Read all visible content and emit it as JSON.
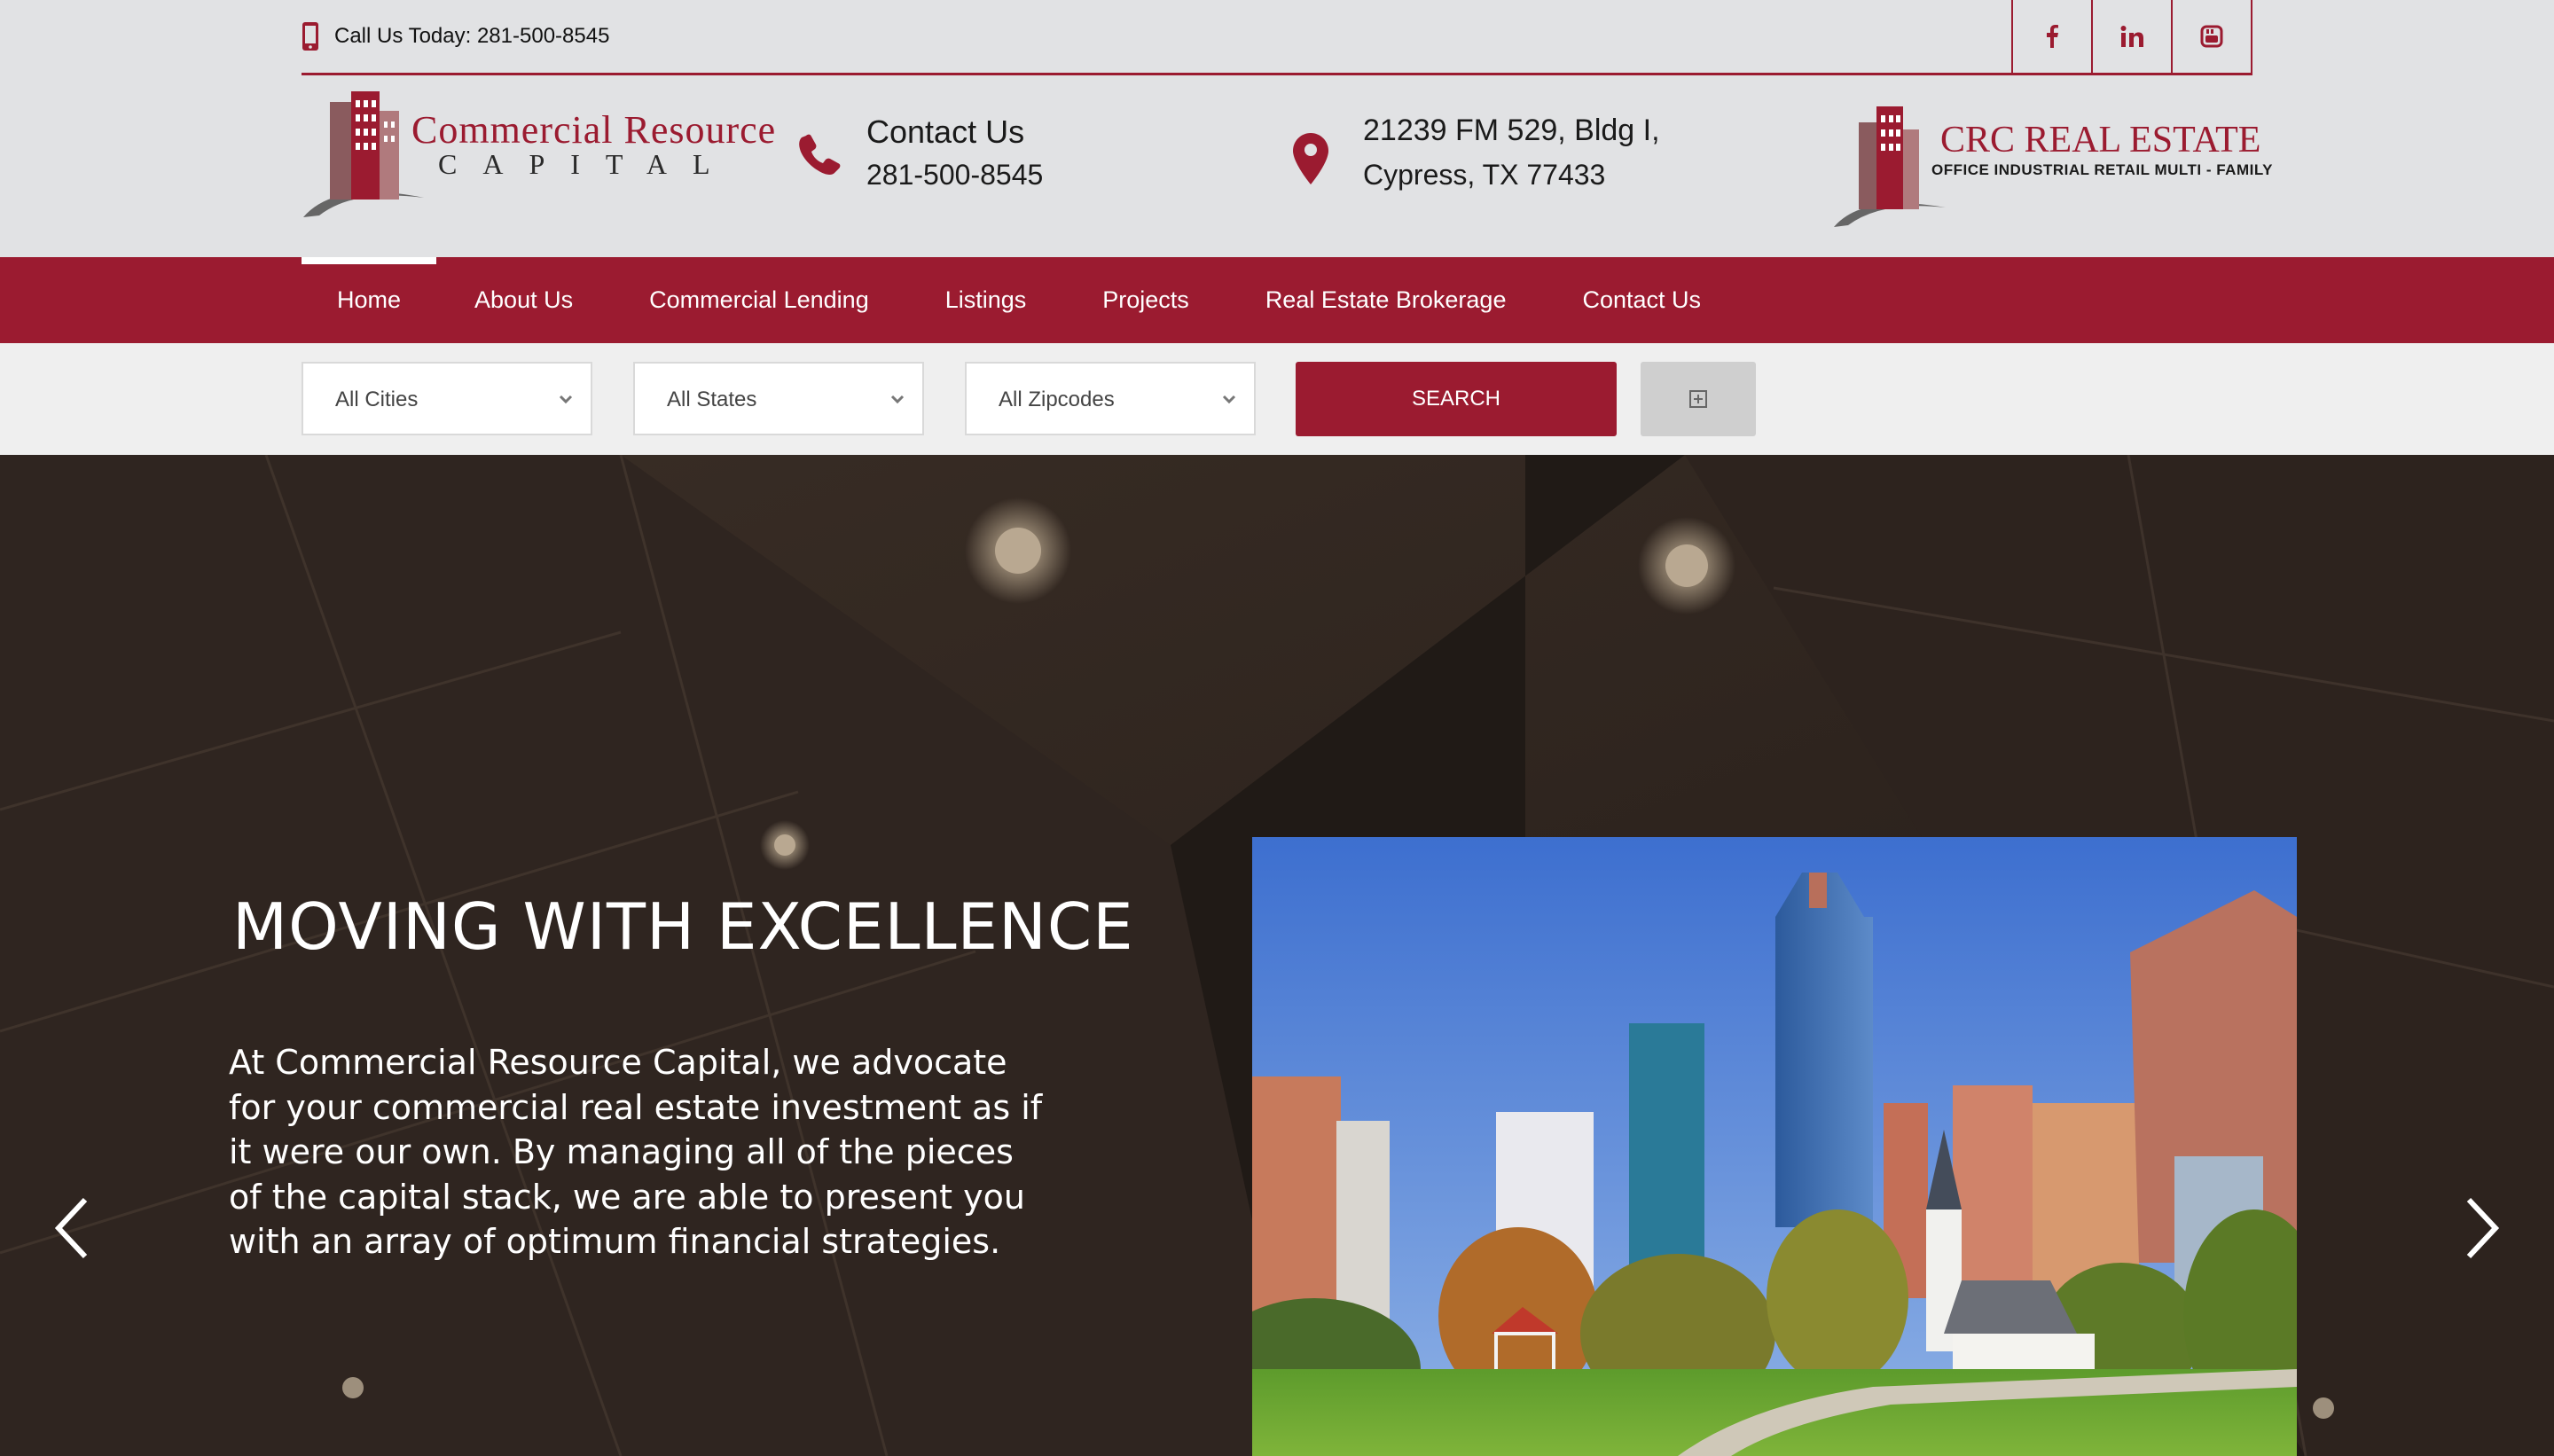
{
  "topbar": {
    "call_text": "Call Us Today: 281-500-8545",
    "social": [
      "facebook-icon",
      "linkedin-icon",
      "youtube-icon"
    ]
  },
  "logo": {
    "line1": "Commercial Resource",
    "line2": "CAPITAL"
  },
  "contact": {
    "title": "Contact Us",
    "phone": "281-500-8545"
  },
  "address": {
    "line1": "21239 FM 529, Bldg I,",
    "line2": "Cypress, TX 77433"
  },
  "logo_re": {
    "line1": "CRC REAL ESTATE",
    "line2": "OFFICE  INDUSTRIAL  RETAIL  MULTI - FAMILY"
  },
  "nav": {
    "items": [
      {
        "label": "Home",
        "active": true
      },
      {
        "label": "About Us"
      },
      {
        "label": "Commercial Lending"
      },
      {
        "label": "Listings"
      },
      {
        "label": "Projects"
      },
      {
        "label": "Real Estate Brokerage"
      },
      {
        "label": "Contact Us"
      }
    ]
  },
  "search": {
    "cities": "All Cities",
    "states": "All States",
    "zipcodes": "All Zipcodes",
    "button": "SEARCH"
  },
  "hero": {
    "title": "MOVING WITH EXCELLENCE",
    "text": "At Commercial Resource Capital, we advocate for your commercial real estate investment as if it were our own. By managing all of the pieces of the capital stack, we are able to present you with an array of optimum financial strategies."
  },
  "colors": {
    "brand": "#9b1b30",
    "nav_text": "#ffffff"
  }
}
